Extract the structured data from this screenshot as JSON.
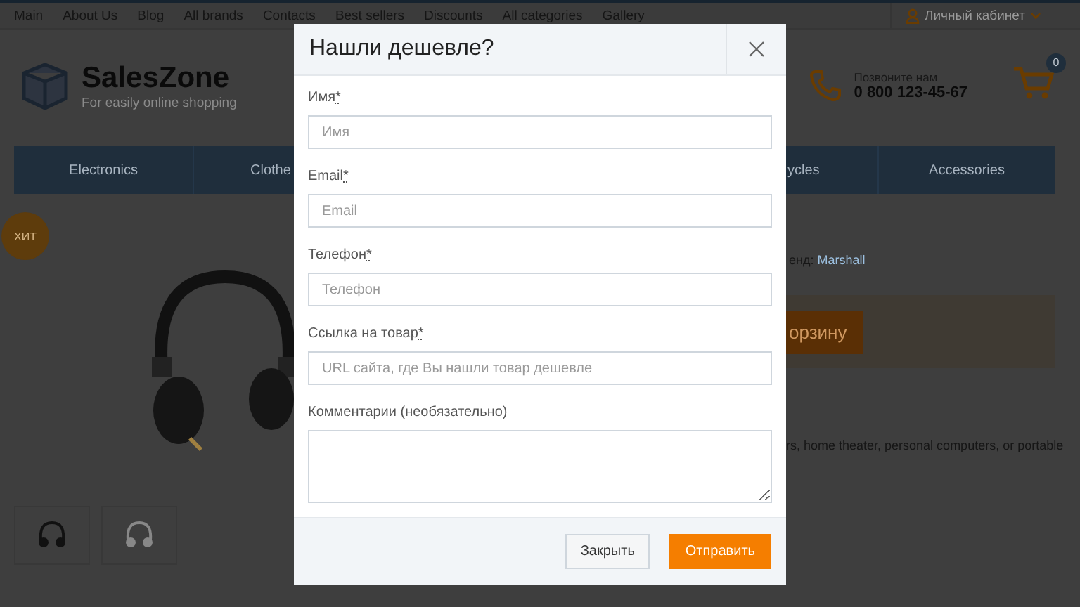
{
  "top_nav": {
    "links": [
      "Main",
      "About Us",
      "Blog",
      "All brands",
      "Contacts",
      "Best sellers",
      "Discounts",
      "All categories",
      "Gallery"
    ],
    "account": "Личный кабинет"
  },
  "header": {
    "logo": "SalesZone",
    "tagline": "For easily online shopping",
    "phone_label": "Позвоните нам",
    "phone": "0 800 123-45-67",
    "cart_count": "0"
  },
  "menu": {
    "left": [
      "Electronics",
      "Clothe"
    ],
    "right": [
      "ycles",
      "Accessories"
    ]
  },
  "product": {
    "badge": "ХИТ",
    "brand_label": "енд:",
    "brand": "Marshall",
    "cart_button": "орзину",
    "description": "rs, home theater, personal computers, or portable"
  },
  "modal": {
    "title": "Нашли дешевле?",
    "fields": [
      {
        "kind": "input",
        "label": "Имя",
        "required_mark": "*",
        "placeholder": "Имя"
      },
      {
        "kind": "input",
        "label": "Email",
        "required_mark": "*",
        "placeholder": "Email"
      },
      {
        "kind": "input",
        "label": "Телефон",
        "required_mark": "*",
        "placeholder": "Телефон"
      },
      {
        "kind": "input",
        "label": "Ссылка на товар",
        "required_mark": "*",
        "placeholder": "URL сайта, где Вы нашли товар дешевле"
      },
      {
        "kind": "textarea",
        "label": "Комментарии (необязательно)"
      }
    ],
    "close_button": "Закрыть",
    "submit_button": "Отправить"
  }
}
